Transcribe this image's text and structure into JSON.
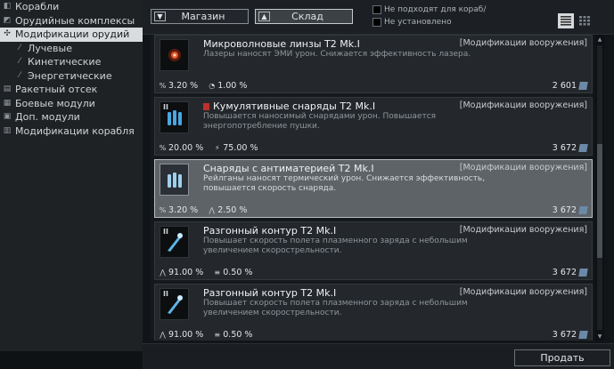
{
  "sidebar": {
    "items": [
      {
        "label": "Корабли",
        "icon": "ship-icon",
        "sub": false,
        "active": false
      },
      {
        "label": "Орудийные комплексы",
        "icon": "weapon-complex-icon",
        "sub": false,
        "active": false
      },
      {
        "label": "Модификации орудий",
        "icon": "weapon-mod-icon",
        "sub": false,
        "active": true
      },
      {
        "label": "Лучевые",
        "icon": "beam-icon",
        "sub": true,
        "active": false
      },
      {
        "label": "Кинетические",
        "icon": "kinetic-icon",
        "sub": true,
        "active": false
      },
      {
        "label": "Энергетические",
        "icon": "energy-icon",
        "sub": true,
        "active": false
      },
      {
        "label": "Ракетный отсек",
        "icon": "missile-icon",
        "sub": false,
        "active": false
      },
      {
        "label": "Боевые модули",
        "icon": "combat-module-icon",
        "sub": false,
        "active": false
      },
      {
        "label": "Доп. модули",
        "icon": "extra-module-icon",
        "sub": false,
        "active": false
      },
      {
        "label": "Модификации корабля",
        "icon": "ship-mod-icon",
        "sub": false,
        "active": false
      }
    ]
  },
  "tabs": {
    "shop": "Магазин",
    "warehouse": "Склад",
    "selected": "warehouse"
  },
  "filters": {
    "not_fit": "Не подходят для кораб/",
    "not_installed": "Не установлено"
  },
  "view_modes": {
    "list_icon": "list-view-icon",
    "grid_icon": "grid-view-icon",
    "selected": "list"
  },
  "items": [
    {
      "title": "Микроволновые линзы Т2 Mk.I",
      "category": "[Модификации вооружения]",
      "desc": "Лазеры наносят ЭМИ урон. Снижается эффективность лазера.",
      "stat1": "3.20 %",
      "stat1_icon": "damage-percent-icon",
      "stat2": "1.00 %",
      "stat2_icon": "efficiency-icon",
      "price": "2 601",
      "thumb": "microwave-lens-icon",
      "tier": "",
      "badge": false,
      "selected": false
    },
    {
      "title": "Кумулятивные снаряды Т2 Mk.I",
      "category": "[Модификации вооружения]",
      "desc": "Повышается наносимый снарядами урон. Повышается энергопотребление пушки.",
      "stat1": "20.00 %",
      "stat1_icon": "damage-percent-icon",
      "stat2": "75.00 %",
      "stat2_icon": "energy-consumption-icon",
      "price": "3 672",
      "thumb": "shells-icon",
      "tier": "II",
      "badge": true,
      "selected": false
    },
    {
      "title": "Снаряды с антиматерией Т2 Mk.I",
      "category": "[Модификации вооружения]",
      "desc": "Рейлганы наносят термический урон. Снижается эффективность, повышается скорость снаряда.",
      "stat1": "3.20 %",
      "stat1_icon": "damage-percent-icon",
      "stat2": "2.50 %",
      "stat2_icon": "projectile-speed-icon",
      "price": "3 672",
      "thumb": "antimatter-shells-icon",
      "tier": "",
      "badge": false,
      "selected": true
    },
    {
      "title": "Разгонный контур Т2 Mk.I",
      "category": "[Модификации вооружения]",
      "desc": "Повышает скорость полета плазменного заряда с небольшим увеличением скорострельности.",
      "stat1": "91.00 %",
      "stat1_icon": "projectile-speed-icon",
      "stat2": "0.50 %",
      "stat2_icon": "fire-rate-icon",
      "price": "3 672",
      "thumb": "accelerator-icon",
      "tier": "II",
      "badge": false,
      "selected": false
    },
    {
      "title": "Разгонный контур Т2 Mk.I",
      "category": "[Модификации вооружения]",
      "desc": "Повышает скорость полета плазменного заряда с небольшим увеличением скорострельности.",
      "stat1": "91.00 %",
      "stat1_icon": "projectile-speed-icon",
      "stat2": "0.50 %",
      "stat2_icon": "fire-rate-icon",
      "price": "3 672",
      "thumb": "accelerator-icon",
      "tier": "II",
      "badge": false,
      "selected": false
    }
  ],
  "scroll": {
    "position": 0.58,
    "visible_fraction": 0.4
  },
  "sell_button": "Продать",
  "colors": {
    "selected_card": "#5e6368",
    "card": "#24282c",
    "badge": "#c0302b",
    "credit": "#6b8aa8"
  }
}
